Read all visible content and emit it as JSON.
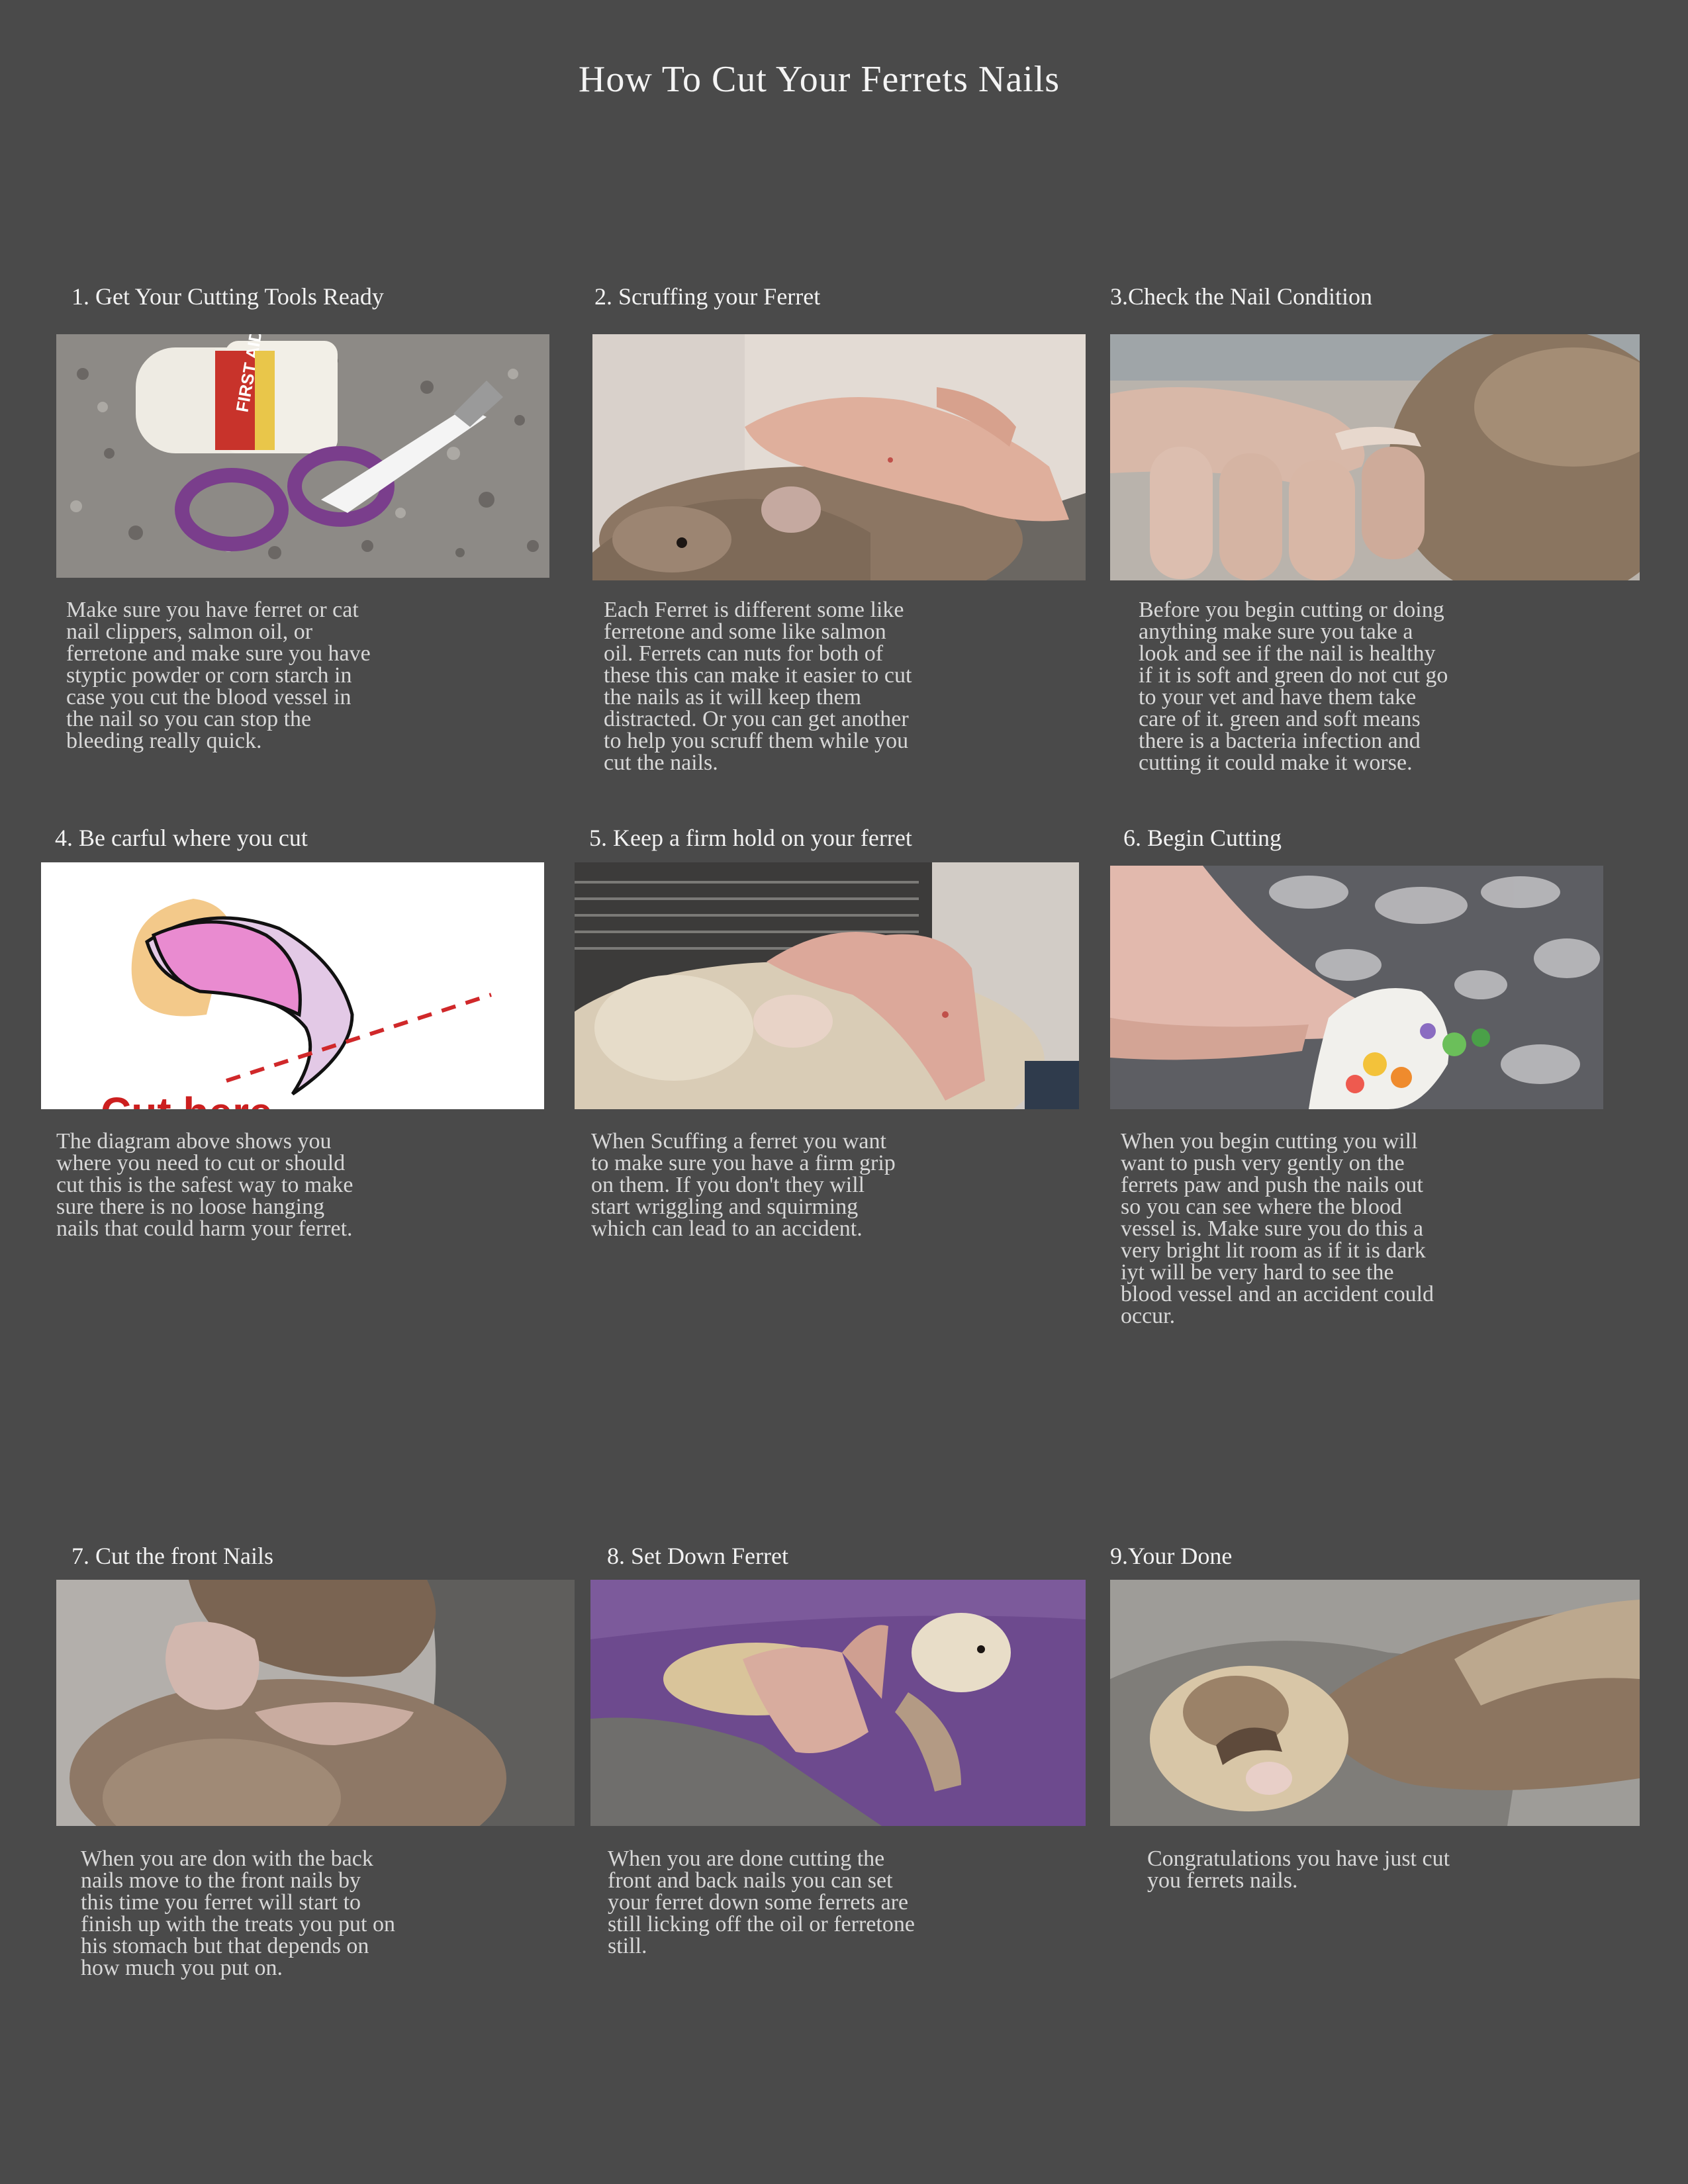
{
  "title": "How To Cut Your Ferrets Nails",
  "steps": [
    {
      "heading": "1. Get Your Cutting Tools Ready",
      "image_icon": "cutting-tools-photo",
      "image_label": "FIRST AID",
      "lines": [
        "Make sure you have ferret or cat",
        "nail clippers, salmon oil, or",
        "ferretone and make sure you have",
        "styptic powder or corn starch in",
        "case you cut the blood vessel in",
        "the nail so you can stop the",
        "bleeding really quick."
      ]
    },
    {
      "heading": "2. Scruffing your Ferret",
      "image_icon": "ferret-scruff-photo",
      "lines": [
        "Each Ferret is different some like",
        "ferretone and some like salmon",
        "oil. Ferrets can nuts for both of",
        "these this can make it easier to cut",
        "the nails as it will keep them",
        "distracted. Or you can get another",
        "to help you scruff them while you",
        "cut the nails."
      ]
    },
    {
      "heading": "3.Check the Nail Condition",
      "image_icon": "nail-check-photo",
      "lines": [
        "Before you begin cutting or doing",
        "anything make sure you take a",
        "look and see if the nail is healthy",
        "if it is soft and green do not cut go",
        "to your vet and have them take",
        "care of it. green and soft means",
        "there is a bacteria infection and",
        "cutting it could make it worse."
      ]
    },
    {
      "heading": "4. Be carful where you cut",
      "image_icon": "nail-diagram",
      "image_label": "Cut here",
      "lines": [
        "The diagram above shows you",
        "where you need to cut or should",
        "cut this is the safest way to make",
        "sure there is no loose hanging",
        "nails that could harm your ferret."
      ]
    },
    {
      "heading": "5. Keep a firm hold on your ferret",
      "image_icon": "firm-hold-photo",
      "lines": [
        "When Scuffing a ferret you want",
        "to make sure you have a firm grip",
        "on them. If you don't they will",
        "start wriggling and squirming",
        "which can lead to an accident."
      ]
    },
    {
      "heading": "6. Begin Cutting",
      "image_icon": "cutting-paw-photo",
      "lines": [
        "When you begin cutting you will",
        "want to push very gently on the",
        "ferrets paw and push the nails out",
        "so you can see where the blood",
        "vessel is. Make sure you do this a",
        "very bright lit room as if it is dark",
        "iyt will be very hard to see the",
        "blood vessel and an accident could",
        "occur."
      ]
    },
    {
      "heading": "7. Cut the front Nails",
      "image_icon": "front-nails-photo",
      "lines": [
        "When you are don with the back",
        "nails move to the front nails by",
        "this time you ferret will start to",
        "finish up with the treats you put on",
        "his stomach but that depends on",
        "how much you put on."
      ]
    },
    {
      "heading": "8. Set Down Ferret",
      "image_icon": "set-down-photo",
      "lines": [
        "When you are done cutting the",
        "front and back nails you can set",
        "your ferret down some ferrets are",
        "still licking off the oil or ferretone",
        "still."
      ]
    },
    {
      "heading": "9.Your Done",
      "image_icon": "resting-ferret-photo",
      "lines": [
        "Congratulations you have just cut",
        "you ferrets nails."
      ]
    }
  ]
}
